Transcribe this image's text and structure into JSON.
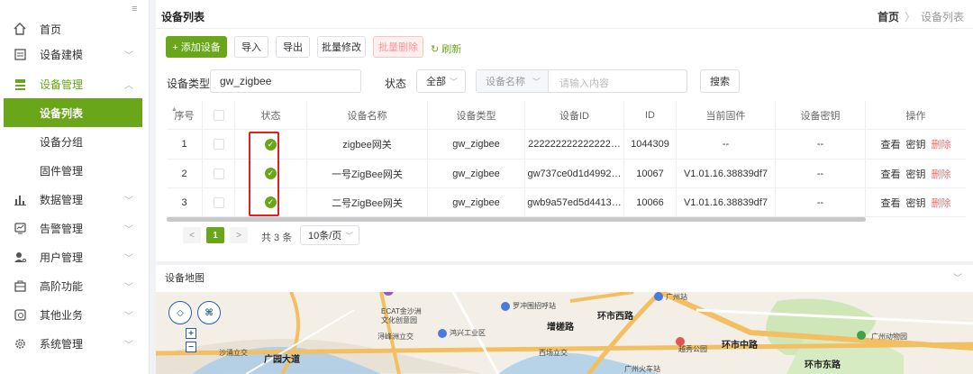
{
  "sidebar": {
    "collapse_icon": "≡",
    "items": [
      {
        "label": "首页",
        "icon": "home-icon"
      },
      {
        "label": "设备建模",
        "icon": "model-icon"
      },
      {
        "label": "设备管理",
        "icon": "device-icon"
      },
      {
        "label": "数据管理",
        "icon": "chart-icon"
      },
      {
        "label": "告警管理",
        "icon": "alarm-icon"
      },
      {
        "label": "用户管理",
        "icon": "user-icon"
      },
      {
        "label": "高阶功能",
        "icon": "advanced-icon"
      },
      {
        "label": "其他业务",
        "icon": "other-icon"
      },
      {
        "label": "系统管理",
        "icon": "settings-icon"
      }
    ],
    "sub_items": [
      {
        "label": "设备列表"
      },
      {
        "label": "设备分组"
      },
      {
        "label": "固件管理"
      }
    ]
  },
  "header": {
    "title": "设备列表",
    "breadcrumb_home": "首页",
    "breadcrumb_current": "设备列表"
  },
  "toolbar": {
    "add_label": "+ 添加设备",
    "import_label": "导入",
    "export_label": "导出",
    "batch_edit_label": "批量修改",
    "batch_delete_label": "批量删除",
    "refresh_label": "↻ 刷新"
  },
  "filters": {
    "type_label": "设备类型",
    "type_value": "gw_zigbee",
    "status_label": "状态",
    "status_value": "全部",
    "field_select": "设备名称",
    "search_placeholder": "请输入内容",
    "search_button": "搜索"
  },
  "table": {
    "headers": [
      "序号",
      "",
      "状态",
      "设备名称",
      "设备类型",
      "设备ID",
      "ID",
      "当前固件",
      "设备密钥",
      "操作"
    ],
    "rows": [
      {
        "index": "1",
        "name": "zigbee网关",
        "type": "gw_zigbee",
        "device_id": "222222222222222…",
        "id": "1044309",
        "firmware": "--",
        "key": "--"
      },
      {
        "index": "2",
        "name": "一号ZigBee网关",
        "type": "gw_zigbee",
        "device_id": "gw737ce0d1d4992…",
        "id": "10067",
        "firmware": "V1.01.16.38839df7",
        "key": "--"
      },
      {
        "index": "3",
        "name": "二号ZigBee网关",
        "type": "gw_zigbee",
        "device_id": "gwb9a57ed5d4413…",
        "id": "10066",
        "firmware": "V1.01.16.38839df7",
        "key": "--"
      }
    ],
    "actions": {
      "view": "查看",
      "key": "密钥",
      "delete": "删除"
    },
    "status_color": "#6aa61a"
  },
  "pagination": {
    "prev": "<",
    "current": "1",
    "next": ">",
    "total": "共 3 条",
    "page_size": "10条/页"
  },
  "map": {
    "title": "设备地图",
    "labels": [
      "ECAT金沙洲",
      "文化创意园",
      "浔峰洲立交",
      "鸿兴工业区",
      "罗冲围招呼站",
      "广州站",
      "越秀公园",
      "广州动物园",
      "西场立交",
      "沙涌立交",
      "广州火车站"
    ],
    "roads": [
      "环市西路",
      "环市中路",
      "环市东路",
      "增槎路",
      "广园大道"
    ]
  },
  "colors": {
    "accent": "#6aa61a",
    "danger": "#f56c6c",
    "highlight": "#e02020"
  }
}
